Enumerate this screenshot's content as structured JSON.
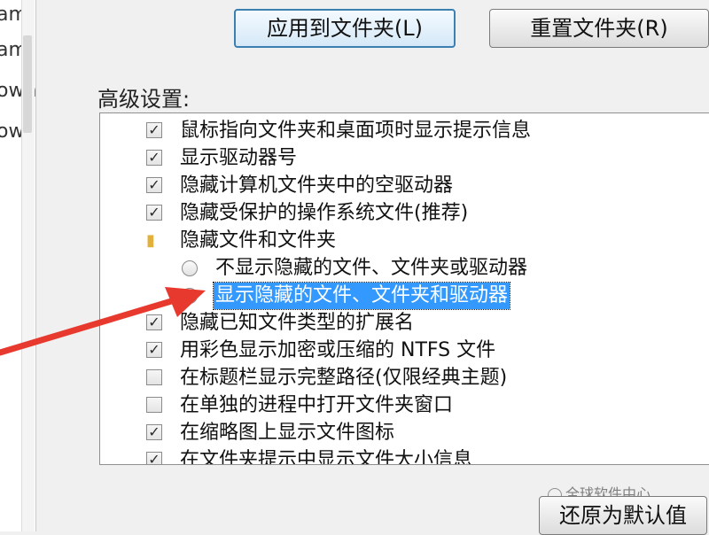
{
  "left_nav": {
    "items": [
      "am",
      "am",
      "own",
      "ows"
    ]
  },
  "buttons": {
    "apply_to_folders": "应用到文件夹(L)",
    "reset_folders": "重置文件夹(R)",
    "restore_defaults": "还原为默认值"
  },
  "advanced": {
    "label": "高级设置:",
    "items": [
      {
        "type": "checkbox",
        "checked": true,
        "label": "鼠标指向文件夹和桌面项时显示提示信息"
      },
      {
        "type": "checkbox",
        "checked": true,
        "label": "显示驱动器号"
      },
      {
        "type": "checkbox",
        "checked": true,
        "label": "隐藏计算机文件夹中的空驱动器"
      },
      {
        "type": "checkbox",
        "checked": true,
        "label": "隐藏受保护的操作系统文件(推荐)"
      },
      {
        "type": "folder",
        "label": "隐藏文件和文件夹"
      },
      {
        "type": "radio",
        "checked": false,
        "label": "不显示隐藏的文件、文件夹或驱动器"
      },
      {
        "type": "radio",
        "checked": true,
        "label": "显示隐藏的文件、文件夹和驱动器"
      },
      {
        "type": "checkbox",
        "checked": true,
        "label": "隐藏已知文件类型的扩展名"
      },
      {
        "type": "checkbox",
        "checked": true,
        "label": "用彩色显示加密或压缩的 NTFS 文件"
      },
      {
        "type": "checkbox",
        "checked": false,
        "label": "在标题栏显示完整路径(仅限经典主题)"
      },
      {
        "type": "checkbox",
        "checked": false,
        "label": "在单独的进程中打开文件夹窗口"
      },
      {
        "type": "checkbox",
        "checked": true,
        "label": "在缩略图上显示文件图标"
      },
      {
        "type": "checkbox",
        "checked": true,
        "label": "在文件夹提示中显示文件大小信息"
      }
    ]
  },
  "watermark": "全球软件中心",
  "colors": {
    "selection": "#3399ff",
    "arrow": "#e8392e",
    "folder": "#e2b13c"
  }
}
